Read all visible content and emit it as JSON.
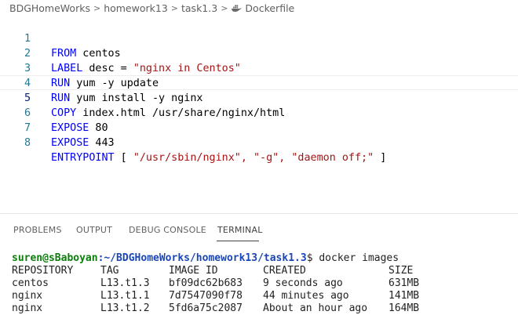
{
  "breadcrumb": {
    "items": [
      "BDGHomeWorks",
      "homework13",
      "task1.3",
      "Dockerfile"
    ],
    "separator": ">"
  },
  "editor": {
    "current_line": 5,
    "lines": [
      {
        "num": "1",
        "keyword": "FROM",
        "rest": " centos",
        "str": "",
        "tail": ""
      },
      {
        "num": "2",
        "keyword": "LABEL",
        "rest": " desc = ",
        "str": "\"nginx in Centos\"",
        "tail": ""
      },
      {
        "num": "3",
        "keyword": "RUN",
        "rest": " yum -y update",
        "str": "",
        "tail": ""
      },
      {
        "num": "4",
        "keyword": "RUN",
        "rest": " yum install -y nginx",
        "str": "",
        "tail": ""
      },
      {
        "num": "5",
        "keyword": "COPY",
        "rest": " index.html /usr/share/nginx/html",
        "str": "",
        "tail": ""
      },
      {
        "num": "6",
        "keyword": "EXPOSE",
        "rest": " 80",
        "str": "",
        "tail": ""
      },
      {
        "num": "7",
        "keyword": "EXPOSE",
        "rest": " 443",
        "str": "",
        "tail": ""
      },
      {
        "num": "8",
        "keyword": "ENTRYPOINT",
        "rest": " [ ",
        "str": "\"/usr/sbin/nginx\", \"-g\", \"daemon off;\"",
        "tail": " ]"
      }
    ]
  },
  "panel": {
    "tabs": [
      "PROBLEMS",
      "OUTPUT",
      "DEBUG CONSOLE",
      "TERMINAL"
    ],
    "active_tab": "TERMINAL"
  },
  "terminal": {
    "prompt_user": "suren@sBaboyan",
    "prompt_path": ":~/BDGHomeWorks/homework13/task1.3",
    "prompt_suffix": "$ ",
    "command": "docker images",
    "headers": [
      "REPOSITORY",
      "TAG",
      "IMAGE ID",
      "CREATED",
      "SIZE"
    ],
    "rows": [
      [
        "centos",
        "L13.t1.3",
        "bf09dc62b683",
        "9 seconds ago",
        "631MB"
      ],
      [
        "nginx",
        "L13.t1.1",
        "7d7547090f78",
        "44 minutes ago",
        "141MB"
      ],
      [
        "nginx",
        "L13.t1.2",
        "5fd6a75c2087",
        "About an hour ago",
        "164MB"
      ]
    ]
  },
  "colors": {
    "keyword": "#0000ff",
    "string": "#a31515",
    "line_number": "#237893",
    "prompt_user": "#0a7d0a",
    "prompt_path": "#1a46b8"
  },
  "icons": {
    "breadcrumb_separator": "chevron-right-icon",
    "dockerfile": "docker-whale-icon"
  }
}
